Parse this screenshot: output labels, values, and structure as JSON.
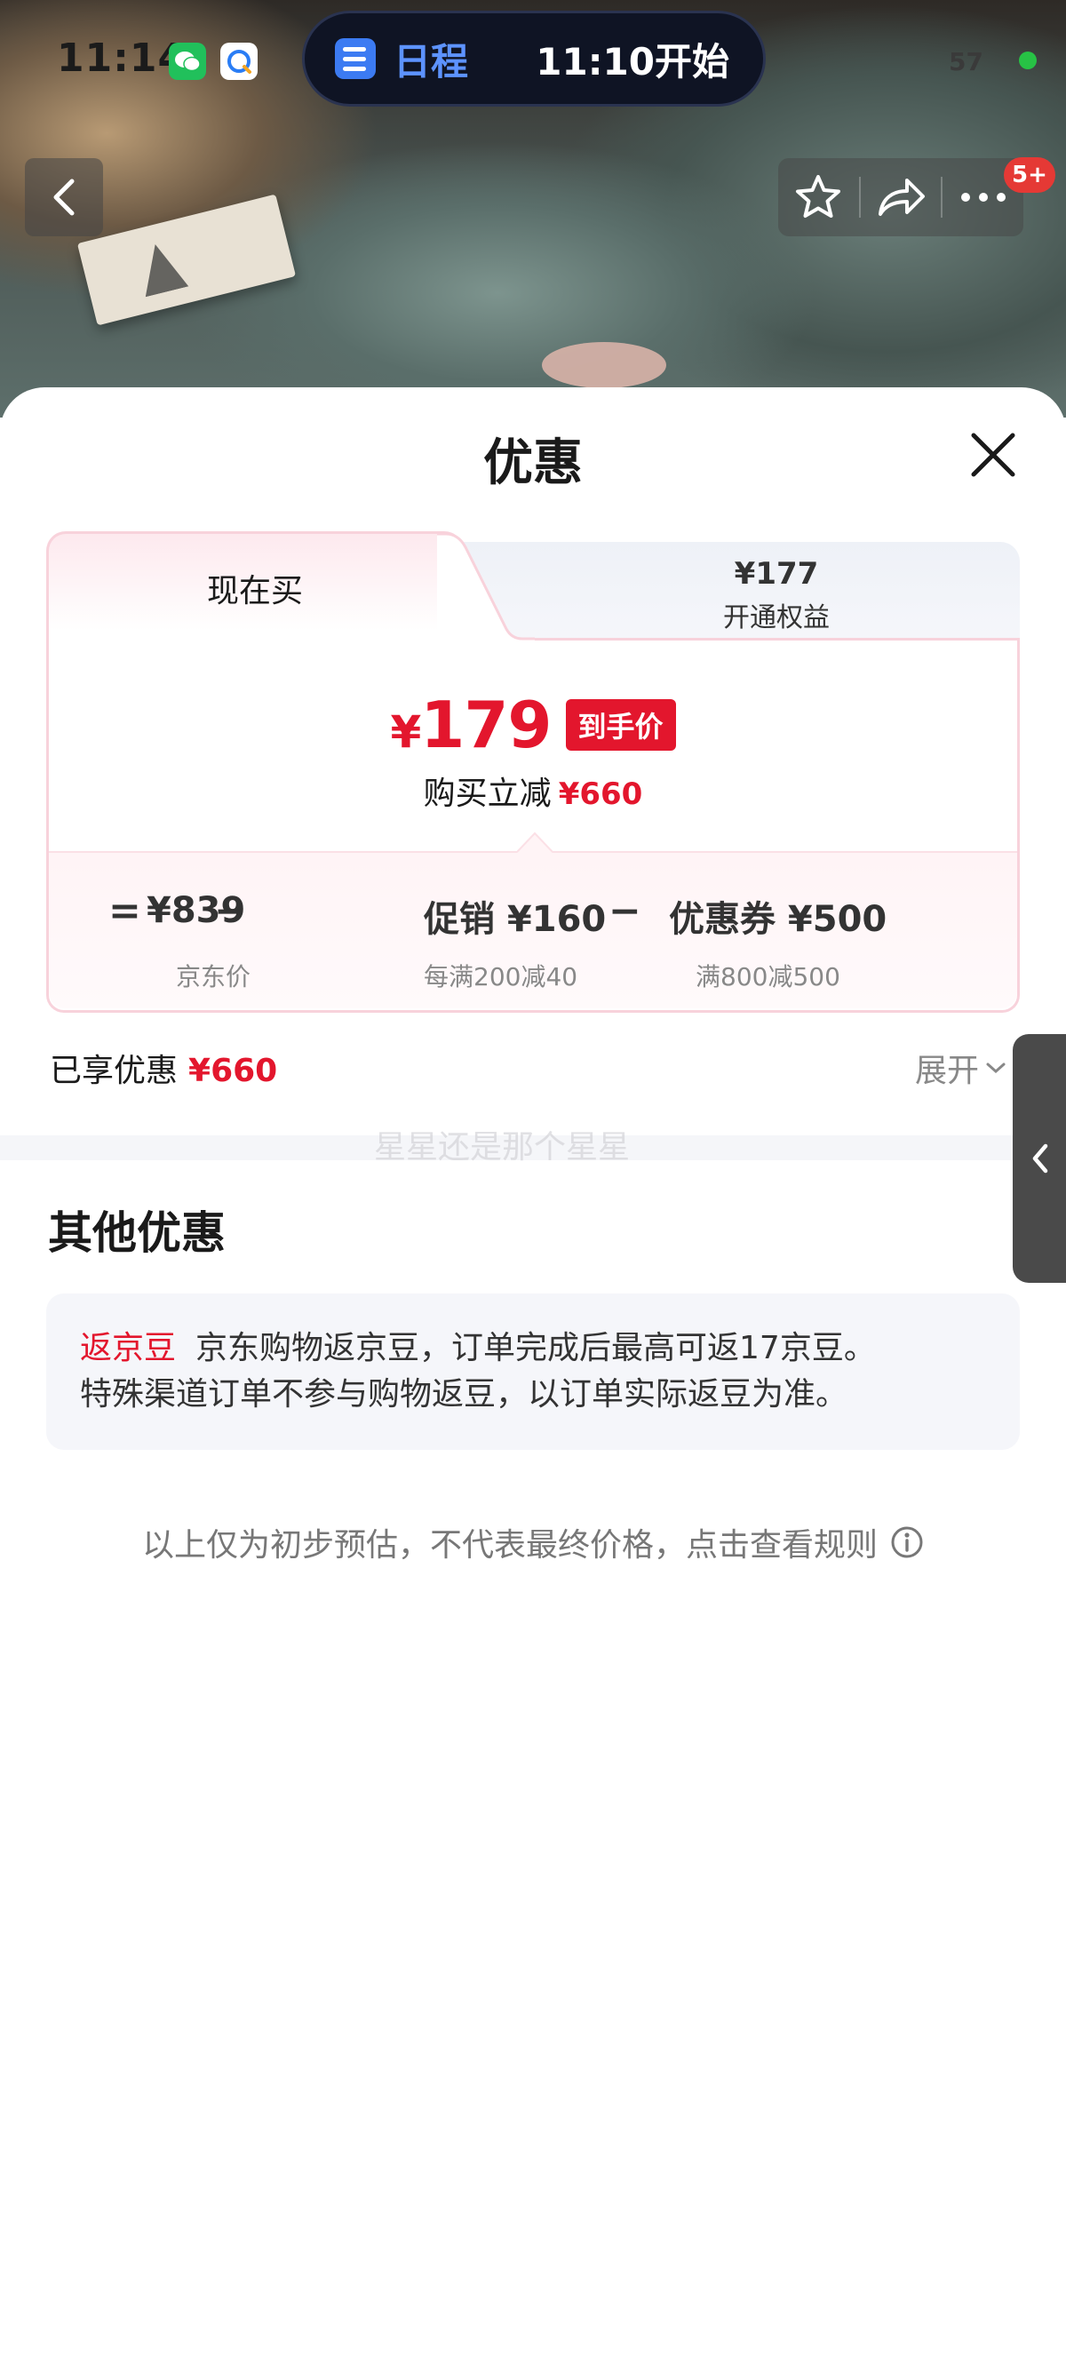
{
  "status_bar": {
    "time": "11:14",
    "pill_label": "日程",
    "pill_time": "11:10开始",
    "battery": "57"
  },
  "photo_controls": {
    "badge": "5+"
  },
  "sheet": {
    "title": "优惠"
  },
  "tabs": {
    "buy_now": "现在买",
    "member_price": "¥177",
    "member_label": "开通权益"
  },
  "price": {
    "currency": "¥",
    "final": "179",
    "final_tag": "到手价",
    "reduce_label": "购买立减",
    "reduce_value": "¥660"
  },
  "breakdown": {
    "equals": "=",
    "minus": "−",
    "items": [
      {
        "value": "¥839",
        "sub": "京东价"
      },
      {
        "value": "促销 ¥160",
        "sub": "每满200减40"
      },
      {
        "value": "优惠券 ¥500",
        "sub": "满800减500"
      }
    ]
  },
  "enjoyed": {
    "label": "已享优惠",
    "value": "¥660",
    "expand": "展开"
  },
  "watermark": "星星还是那个星星",
  "other": {
    "title": "其他优惠",
    "bean_tag": "返京豆",
    "bean_line1": "京东购物返京豆，订单完成后最高可返17京豆。",
    "bean_line2": "特殊渠道订单不参与购物返豆，以订单实际返豆为准。"
  },
  "footnote": "以上仅为初步预估，不代表最终价格，点击查看规则",
  "colors": {
    "accent_red": "#e3162d",
    "card_border": "#f8d2db"
  }
}
